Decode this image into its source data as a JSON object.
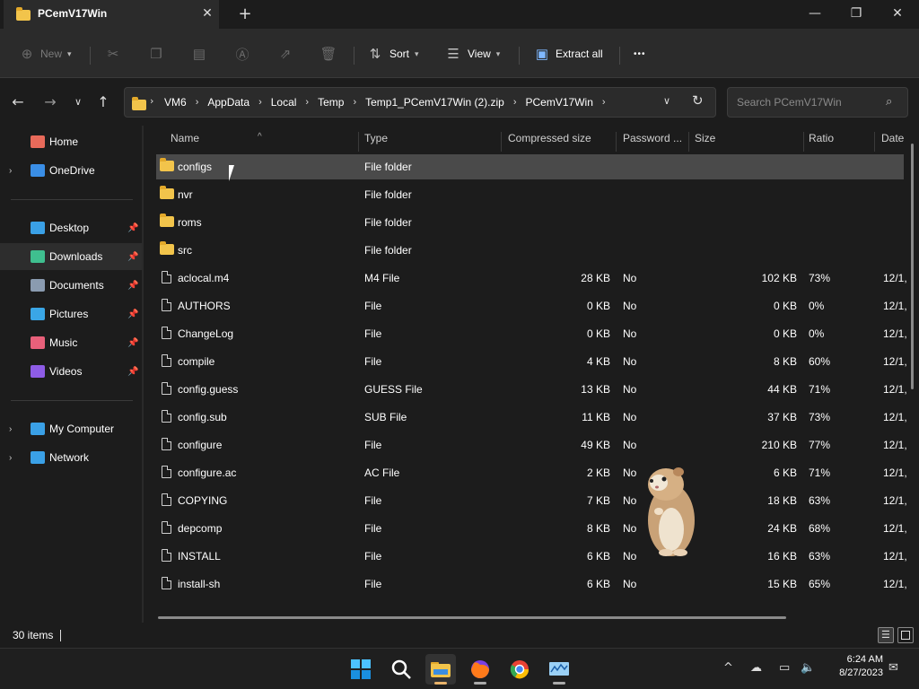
{
  "window": {
    "tab_title": "PCemV17Win",
    "tab_close": "✕",
    "new_tab": "+",
    "minimize": "—",
    "maximize": "❐",
    "close": "✕"
  },
  "toolbar": {
    "new_label": "New",
    "sort_label": "Sort",
    "view_label": "View",
    "extract_label": "Extract all",
    "more_label": "•••"
  },
  "address": {
    "crumbs": [
      "VM6",
      "AppData",
      "Local",
      "Temp",
      "Temp1_PCemV17Win (2).zip",
      "PCemV17Win"
    ],
    "search_placeholder": "Search PCemV17Win"
  },
  "sidebar": {
    "items": [
      {
        "label": "Home",
        "icon": "home-icon",
        "color": "#e86a5a"
      },
      {
        "label": "OneDrive",
        "icon": "cloud-icon",
        "color": "#3a8ee6"
      },
      {
        "label": "Desktop",
        "icon": "desktop-icon",
        "color": "#3aa0e6"
      },
      {
        "label": "Downloads",
        "icon": "download-icon",
        "color": "#3fbf8f"
      },
      {
        "label": "Documents",
        "icon": "document-icon",
        "color": "#8a9bb0"
      },
      {
        "label": "Pictures",
        "icon": "picture-icon",
        "color": "#3aa6e6"
      },
      {
        "label": "Music",
        "icon": "music-icon",
        "color": "#e8607a"
      },
      {
        "label": "Videos",
        "icon": "video-icon",
        "color": "#8e5ce6"
      },
      {
        "label": "My Computer",
        "icon": "computer-icon",
        "color": "#3aa0e6"
      },
      {
        "label": "Network",
        "icon": "network-icon",
        "color": "#3aa0e6"
      }
    ]
  },
  "columns": {
    "name": "Name",
    "type": "Type",
    "compressed": "Compressed size",
    "password": "Password ...",
    "size": "Size",
    "ratio": "Ratio",
    "date": "Date"
  },
  "files": [
    {
      "name": "configs",
      "type": "File folder",
      "compressed": "",
      "password": "",
      "size": "",
      "ratio": "",
      "date": "",
      "folder": true
    },
    {
      "name": "nvr",
      "type": "File folder",
      "compressed": "",
      "password": "",
      "size": "",
      "ratio": "",
      "date": "",
      "folder": true
    },
    {
      "name": "roms",
      "type": "File folder",
      "compressed": "",
      "password": "",
      "size": "",
      "ratio": "",
      "date": "",
      "folder": true
    },
    {
      "name": "src",
      "type": "File folder",
      "compressed": "",
      "password": "",
      "size": "",
      "ratio": "",
      "date": "",
      "folder": true
    },
    {
      "name": "aclocal.m4",
      "type": "M4 File",
      "compressed": "28 KB",
      "password": "No",
      "size": "102 KB",
      "ratio": "73%",
      "date": "12/1,"
    },
    {
      "name": "AUTHORS",
      "type": "File",
      "compressed": "0 KB",
      "password": "No",
      "size": "0 KB",
      "ratio": "0%",
      "date": "12/1,"
    },
    {
      "name": "ChangeLog",
      "type": "File",
      "compressed": "0 KB",
      "password": "No",
      "size": "0 KB",
      "ratio": "0%",
      "date": "12/1,"
    },
    {
      "name": "compile",
      "type": "File",
      "compressed": "4 KB",
      "password": "No",
      "size": "8 KB",
      "ratio": "60%",
      "date": "12/1,"
    },
    {
      "name": "config.guess",
      "type": "GUESS File",
      "compressed": "13 KB",
      "password": "No",
      "size": "44 KB",
      "ratio": "71%",
      "date": "12/1,"
    },
    {
      "name": "config.sub",
      "type": "SUB File",
      "compressed": "11 KB",
      "password": "No",
      "size": "37 KB",
      "ratio": "73%",
      "date": "12/1,"
    },
    {
      "name": "configure",
      "type": "File",
      "compressed": "49 KB",
      "password": "No",
      "size": "210 KB",
      "ratio": "77%",
      "date": "12/1,"
    },
    {
      "name": "configure.ac",
      "type": "AC File",
      "compressed": "2 KB",
      "password": "No",
      "size": "6 KB",
      "ratio": "71%",
      "date": "12/1,"
    },
    {
      "name": "COPYING",
      "type": "File",
      "compressed": "7 KB",
      "password": "No",
      "size": "18 KB",
      "ratio": "63%",
      "date": "12/1,"
    },
    {
      "name": "depcomp",
      "type": "File",
      "compressed": "8 KB",
      "password": "No",
      "size": "24 KB",
      "ratio": "68%",
      "date": "12/1,"
    },
    {
      "name": "INSTALL",
      "type": "File",
      "compressed": "6 KB",
      "password": "No",
      "size": "16 KB",
      "ratio": "63%",
      "date": "12/1,"
    },
    {
      "name": "install-sh",
      "type": "File",
      "compressed": "6 KB",
      "password": "No",
      "size": "15 KB",
      "ratio": "65%",
      "date": "12/1,"
    }
  ],
  "status": {
    "item_count": "30 items"
  },
  "clock": {
    "time": "6:24 AM",
    "date": "8/27/2023"
  }
}
